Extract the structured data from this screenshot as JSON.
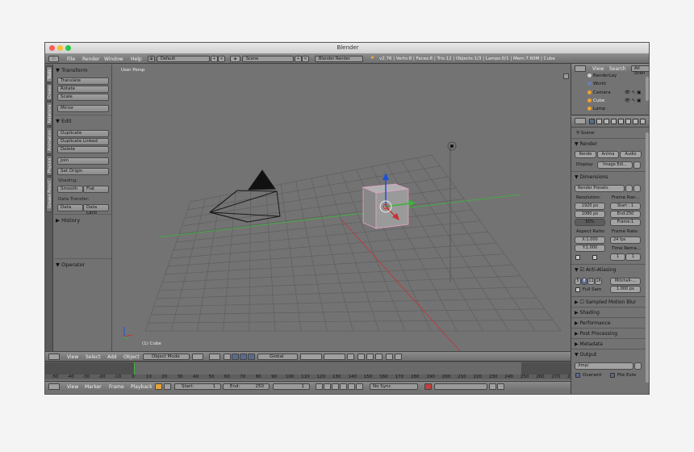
{
  "window": {
    "title": "Blender"
  },
  "info_bar": {
    "menus": [
      "File",
      "Render",
      "Window",
      "Help"
    ],
    "layout": "Default",
    "scene": "Scene",
    "engine": "Blender Render",
    "stats": "v2.76 | Verts:8 | Faces:6 | Tris:12 | Objects:1/3 | Lamps:0/1 | Mem:7.60M | Cube"
  },
  "tool_tabs": [
    "Tools",
    "Create",
    "Relations",
    "Animation",
    "Physics",
    "Grease Pencil"
  ],
  "toolshelf": {
    "transform_header": "Transform",
    "translate": "Translate",
    "rotate": "Rotate",
    "scale": "Scale",
    "mirror": "Mirror",
    "edit_header": "Edit",
    "duplicate": "Duplicate",
    "duplicate_linked": "Duplicate Linked",
    "delete": "Delete",
    "join": "Join",
    "set_origin": "Set Origin",
    "shading_label": "Shading:",
    "smooth": "Smooth",
    "flat": "Flat",
    "data_transfer_label": "Data Transfer:",
    "data": "Data",
    "data_layout": "Data Layo",
    "history_header": "History",
    "operator_header": "Operator"
  },
  "viewport": {
    "view_name": "User Persp",
    "object_label": "(1) Cube"
  },
  "header_3d": {
    "menus": [
      "View",
      "Select",
      "Add",
      "Object"
    ],
    "mode": "Object Mode",
    "orientation": "Global"
  },
  "timeline": {
    "ticks": [
      "-50",
      "-40",
      "-30",
      "-20",
      "-10",
      "0",
      "10",
      "20",
      "30",
      "40",
      "50",
      "60",
      "70",
      "80",
      "90",
      "100",
      "110",
      "120",
      "130",
      "140",
      "150",
      "160",
      "170",
      "180",
      "190",
      "200",
      "210",
      "220",
      "230",
      "240",
      "250",
      "260",
      "270",
      "280"
    ],
    "menus": [
      "View",
      "Marker",
      "Frame",
      "Playback"
    ],
    "start_label": "Start:",
    "start_value": "1",
    "end_label": "End:",
    "end_value": "250",
    "current_frame": "1",
    "sync": "No Sync"
  },
  "outliner": {
    "view": "View",
    "search": "Search",
    "filter": "All Scen",
    "items": [
      "RenderLay",
      "World",
      "Camera",
      "Cube",
      "Lamp"
    ]
  },
  "properties": {
    "scene": "Scene",
    "render_header": "Render",
    "render_btn": "Rende",
    "anim_btn": "Anima",
    "audio_btn": "Audio",
    "display_label": "Display:",
    "display_value": "Image Edi...",
    "dimensions_header": "Dimensions",
    "render_presets": "Render Presets",
    "resolution_label": "Resolution:",
    "res_x": "1920 px",
    "res_y": "1080 px",
    "res_pct": "50%",
    "frame_range_label": "Frame Ran...",
    "start": "Start : 1",
    "end": "End:250",
    "frame": "Frame:1",
    "aspect_label": "Aspect Ratio:",
    "aspect_x": "X:1.000",
    "aspect_y": "Y:1.000",
    "frame_rate_label": "Frame Rate:",
    "fps": "24 fps",
    "time_remap_label": "Time Rema...",
    "remap_old": "1",
    "remap_new": "1",
    "aa_header": "Anti-Aliasing",
    "aa_samples": [
      "5",
      "8",
      "11",
      "16"
    ],
    "aa_filter": "Mitchell-...",
    "full_sample": "Full Sam",
    "aa_size": "1.000 px",
    "smb_header": "Sampled Motion Blur",
    "shading_header": "Shading",
    "performance_header": "Performance",
    "post_header": "Post Processing",
    "metadata_header": "Metadata",
    "output_header": "Output",
    "output_path": "/tmp/",
    "overwrite": "Overwrit",
    "file_ext": "File Exte"
  },
  "colors": {
    "cube_face": "#9a9a9a",
    "x_axis": "#c83232",
    "y_axis": "#3cb43c",
    "z_axis": "#1e50dc",
    "selection": "#e8a3c8"
  }
}
